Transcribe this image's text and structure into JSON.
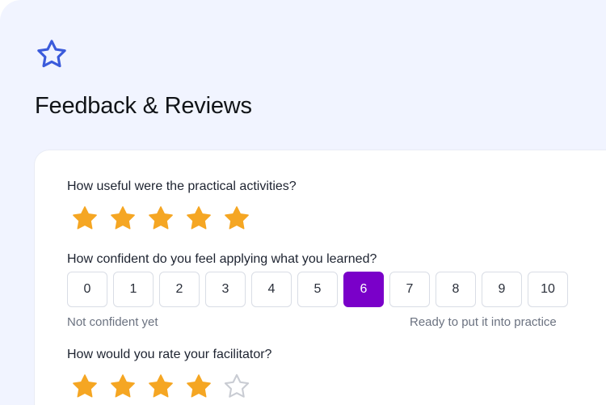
{
  "header": {
    "icon": "star-outline-icon",
    "title": "Feedback & Reviews",
    "accent": "#3b5bdb"
  },
  "questions": [
    {
      "label": "How useful were the practical activities?",
      "type": "stars",
      "rating": 5,
      "max": 5
    },
    {
      "label": "How confident do you feel applying what you learned?",
      "type": "scale",
      "options": [
        "0",
        "1",
        "2",
        "3",
        "4",
        "5",
        "6",
        "7",
        "8",
        "9",
        "10"
      ],
      "selected": "6",
      "min_hint": "Not confident yet",
      "max_hint": "Ready to put it into practice"
    },
    {
      "label": "How would you rate your facilitator?",
      "type": "stars",
      "rating": 4,
      "max": 5
    }
  ],
  "colors": {
    "star_filled": "#f5a623",
    "star_empty": "#c9ccd3",
    "selected": "#7a00c9"
  }
}
